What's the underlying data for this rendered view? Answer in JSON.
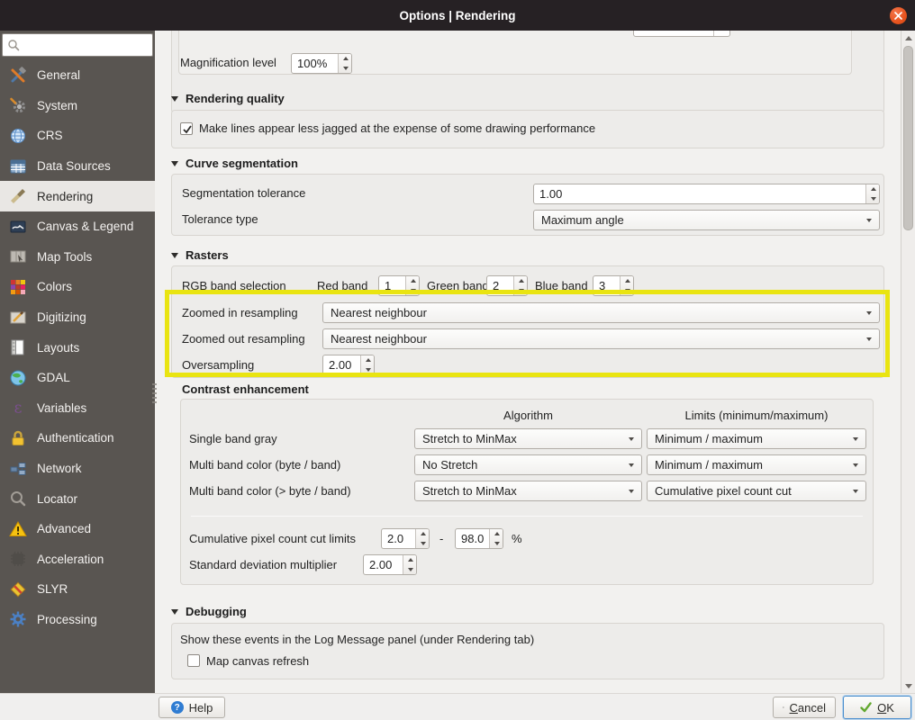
{
  "window": {
    "title": "Options | Rendering"
  },
  "sidebar": {
    "search_placeholder": "",
    "items": [
      {
        "label": "General",
        "icon": "tools-icon",
        "selected": false
      },
      {
        "label": "System",
        "icon": "system-gear-icon",
        "selected": false
      },
      {
        "label": "CRS",
        "icon": "globe-icon",
        "selected": false
      },
      {
        "label": "Data Sources",
        "icon": "data-table-icon",
        "selected": false
      },
      {
        "label": "Rendering",
        "icon": "paintbrush-icon",
        "selected": true
      },
      {
        "label": "Canvas & Legend",
        "icon": "canvas-picture-icon",
        "selected": false
      },
      {
        "label": "Map Tools",
        "icon": "map-cursor-icon",
        "selected": false
      },
      {
        "label": "Colors",
        "icon": "color-swatches-icon",
        "selected": false
      },
      {
        "label": "Digitizing",
        "icon": "map-pencil-icon",
        "selected": false
      },
      {
        "label": "Layouts",
        "icon": "page-layout-icon",
        "selected": false
      },
      {
        "label": "GDAL",
        "icon": "earth-icon",
        "selected": false
      },
      {
        "label": "Variables",
        "icon": "epsilon-icon",
        "selected": false
      },
      {
        "label": "Authentication",
        "icon": "lock-icon",
        "selected": false
      },
      {
        "label": "Network",
        "icon": "network-icon",
        "selected": false
      },
      {
        "label": "Locator",
        "icon": "magnifier-icon",
        "selected": false
      },
      {
        "label": "Advanced",
        "icon": "warning-triangle-icon",
        "selected": false
      },
      {
        "label": "Acceleration",
        "icon": "chip-icon",
        "selected": false
      },
      {
        "label": "SLYR",
        "icon": "slyr-diamond-icon",
        "selected": false
      },
      {
        "label": "Processing",
        "icon": "processing-gear-icon",
        "selected": false
      }
    ]
  },
  "content": {
    "magnification": {
      "label": "Magnification level",
      "value": "100%"
    },
    "rendering_quality": {
      "header": "Rendering quality",
      "antialias": {
        "label": "Make lines appear less jagged at the expense of some drawing performance",
        "checked": true
      }
    },
    "curve_segmentation": {
      "header": "Curve segmentation",
      "tolerance": {
        "label": "Segmentation tolerance",
        "value": "1.00"
      },
      "tolerance_type": {
        "label": "Tolerance type",
        "value": "Maximum angle"
      }
    },
    "rasters": {
      "header": "Rasters",
      "rgb": {
        "label": "RGB band selection",
        "red_label": "Red band",
        "red": "1",
        "green_label": "Green band",
        "green": "2",
        "blue_label": "Blue band",
        "blue": "3"
      },
      "zoom_in": {
        "label": "Zoomed in resampling",
        "value": "Nearest neighbour"
      },
      "zoom_out": {
        "label": "Zoomed out resampling",
        "value": "Nearest neighbour"
      },
      "oversampling": {
        "label": "Oversampling",
        "value": "2.00"
      }
    },
    "contrast": {
      "header": "Contrast enhancement",
      "col_algorithm": "Algorithm",
      "col_limits": "Limits (minimum/maximum)",
      "rows": [
        {
          "label": "Single band gray",
          "algorithm": "Stretch to MinMax",
          "limits": "Minimum / maximum"
        },
        {
          "label": "Multi band color (byte / band)",
          "algorithm": "No Stretch",
          "limits": "Minimum / maximum"
        },
        {
          "label": "Multi band color (> byte / band)",
          "algorithm": "Stretch to MinMax",
          "limits": "Cumulative pixel count cut"
        }
      ],
      "cumulative": {
        "label": "Cumulative pixel count cut limits",
        "min": "2.0",
        "dash": "-",
        "max": "98.0",
        "percent": "%"
      },
      "stddev": {
        "label": "Standard deviation multiplier",
        "value": "2.00"
      }
    },
    "debugging": {
      "header": "Debugging",
      "note": "Show these events in the Log Message panel (under Rendering tab)",
      "map_canvas_refresh": {
        "label": "Map canvas refresh",
        "checked": false
      }
    }
  },
  "footer": {
    "help": "Help",
    "cancel": "Cancel",
    "ok": "OK"
  },
  "colors": {
    "highlight_yellow": "#e9e411",
    "titlebar": "#262124",
    "close_button": "#e8541f",
    "sidebar_bg": "#595551",
    "selected_item_bg": "#e9e7e4",
    "default_button_border": "#4c8fce"
  }
}
